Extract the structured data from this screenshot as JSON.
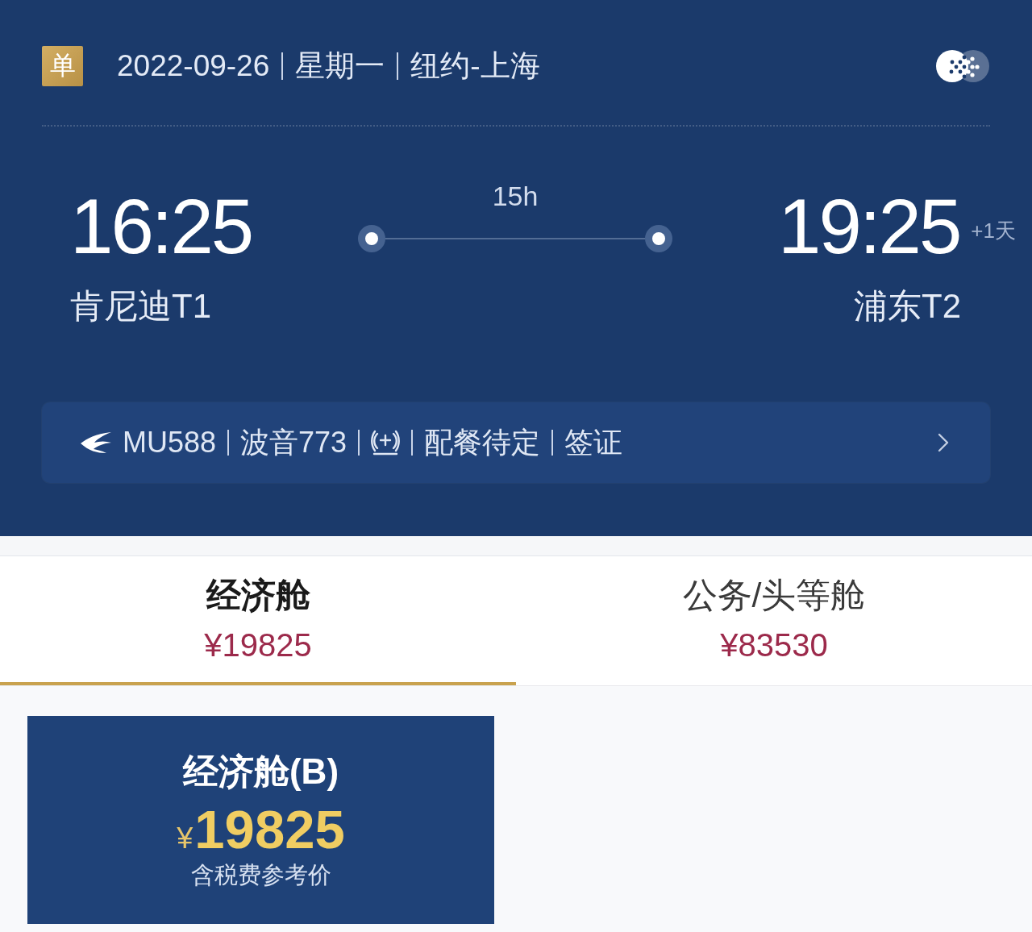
{
  "header": {
    "badge": "单",
    "parts": [
      "2022-09-26",
      "星期一",
      "纽约-上海"
    ]
  },
  "flight": {
    "departure": {
      "time": "16:25",
      "airport": "肯尼迪T1"
    },
    "duration": "15h",
    "arrival": {
      "time": "19:25",
      "day_offset": "+1天",
      "airport": "浦东T2"
    }
  },
  "info_bar": {
    "segments": [
      {
        "kind": "airline",
        "text": "MU588"
      },
      {
        "kind": "text",
        "text": "波音773"
      },
      {
        "kind": "amenity"
      },
      {
        "kind": "text",
        "text": "配餐待定"
      },
      {
        "kind": "text",
        "text": "签证"
      }
    ]
  },
  "cabin_tabs": [
    {
      "label": "经济舱",
      "price": "¥19825",
      "selected": true
    },
    {
      "label": "公务/头等舱",
      "price": "¥83530",
      "selected": false
    }
  ],
  "fare_card": {
    "title": "经济舱(B)",
    "currency": "¥",
    "price": "19825",
    "note": "含税费参考价"
  }
}
